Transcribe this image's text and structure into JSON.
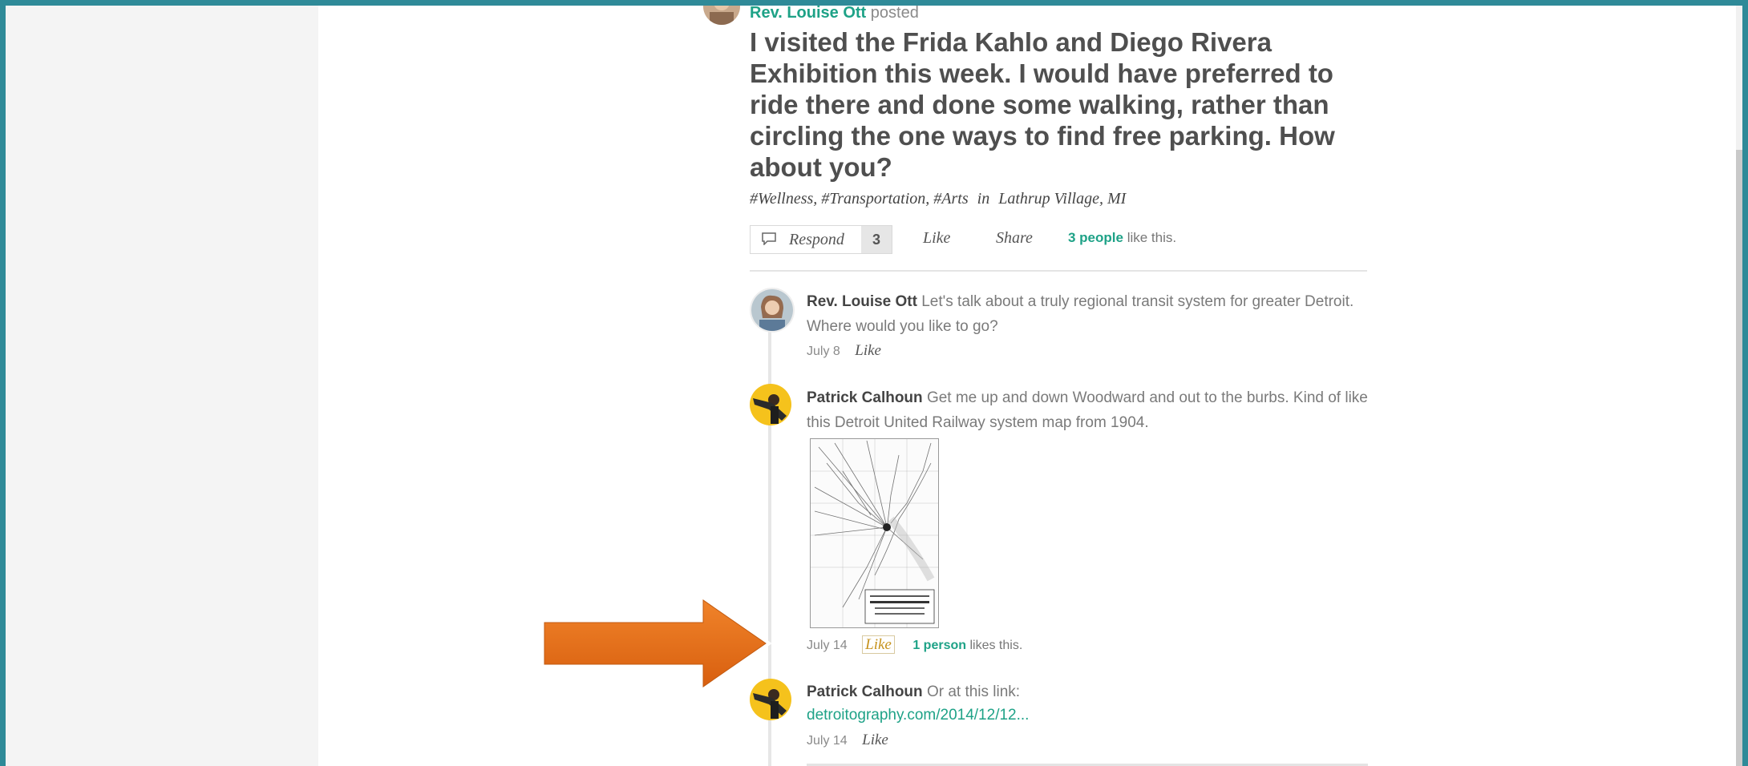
{
  "post": {
    "author": "Rev. Louise Ott",
    "verb": "posted",
    "title": "I visited the Frida Kahlo and Diego Rivera Exhibition this week. I would have preferred to ride there and done some walking, rather than circling the one ways to find free parking. How about you?",
    "tags": "#Wellness, #Transportation, #Arts",
    "location_prefix": "in",
    "location": "Lathrup Village, MI",
    "respond_label": "Respond",
    "respond_count": "3",
    "like_label": "Like",
    "share_label": "Share",
    "likes_count": "3 people",
    "likes_suffix": "like this."
  },
  "comments": [
    {
      "author": "Rev. Louise Ott",
      "text": "Let's talk about a truly regional transit system for greater Detroit. Where would you like to go?",
      "date": "July 8",
      "like_label": "Like"
    },
    {
      "author": "Patrick Calhoun",
      "text": "Get me up and down Woodward and out to the burbs. Kind of like this Detroit United Railway system map from 1904.",
      "image": "detroit-united-railway-map",
      "map_caption": "MAP OF THE DETROIT UNITED RAILWAY",
      "date": "July 14",
      "like_label": "Like",
      "likes_count": "1 person",
      "likes_suffix": "likes this."
    },
    {
      "author": "Patrick Calhoun",
      "text": "Or at this link:",
      "link": "detroitography.com/2014/12/12...",
      "date": "July 14",
      "like_label": "Like"
    }
  ],
  "annotation": {
    "icon": "orange-arrow-right-icon",
    "color": "#e8711c"
  },
  "colors": {
    "accent": "#1ea287",
    "frame": "#2f8a98",
    "headline": "#4f4f4f"
  }
}
